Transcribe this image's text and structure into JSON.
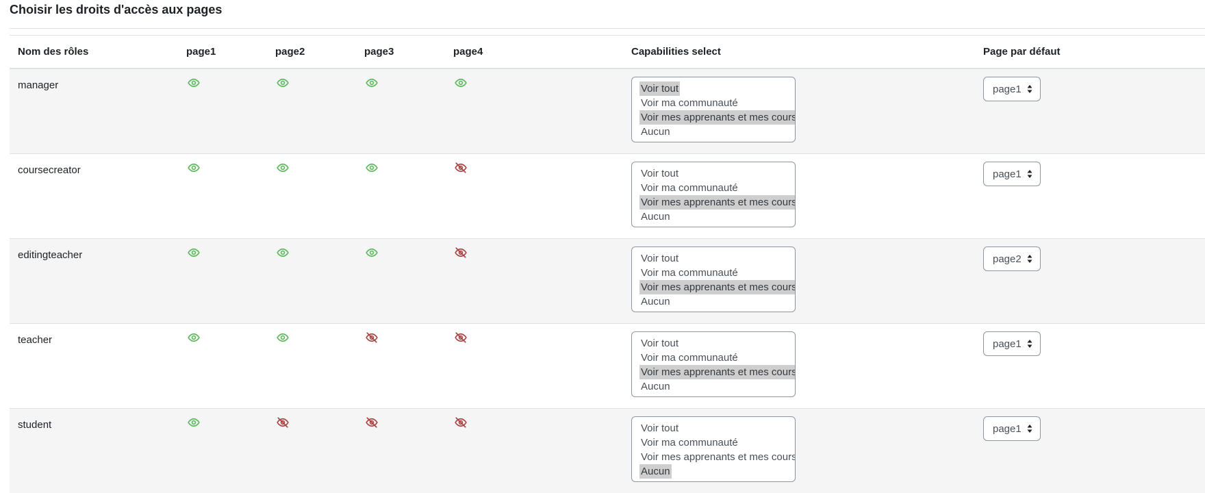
{
  "page": {
    "title": "Choisir les droits d'accès aux pages"
  },
  "colors": {
    "visible": "#5cb85c",
    "hidden": "#a94442",
    "selected_bg": "#cecece",
    "stripe": "#f5f5f5"
  },
  "table": {
    "headers": {
      "role": "Nom des rôles",
      "page1": "page1",
      "page2": "page2",
      "page3": "page3",
      "page4": "page4",
      "capabilities": "Capabilities select",
      "default_page": "Page par défaut"
    },
    "capability_options": [
      "Voir tout",
      "Voir ma communauté",
      "Voir mes apprenants et mes cours",
      "Aucun"
    ],
    "rows": [
      {
        "role": "manager",
        "pages": [
          "eye-icon",
          "eye-icon",
          "eye-icon",
          "eye-icon"
        ],
        "capabilities_selected": [
          "Voir tout",
          "Voir mes apprenants et mes cours"
        ],
        "default_page": "page1"
      },
      {
        "role": "coursecreator",
        "pages": [
          "eye-icon",
          "eye-icon",
          "eye-icon",
          "eye-slash-icon"
        ],
        "capabilities_selected": [
          "Voir mes apprenants et mes cours"
        ],
        "default_page": "page1"
      },
      {
        "role": "editingteacher",
        "pages": [
          "eye-icon",
          "eye-icon",
          "eye-icon",
          "eye-slash-icon"
        ],
        "capabilities_selected": [
          "Voir mes apprenants et mes cours"
        ],
        "default_page": "page2"
      },
      {
        "role": "teacher",
        "pages": [
          "eye-icon",
          "eye-icon",
          "eye-slash-icon",
          "eye-slash-icon"
        ],
        "capabilities_selected": [
          "Voir mes apprenants et mes cours"
        ],
        "default_page": "page1"
      },
      {
        "role": "student",
        "pages": [
          "eye-icon",
          "eye-slash-icon",
          "eye-slash-icon",
          "eye-slash-icon"
        ],
        "capabilities_selected": [
          "Aucun"
        ],
        "default_page": "page1"
      }
    ]
  }
}
